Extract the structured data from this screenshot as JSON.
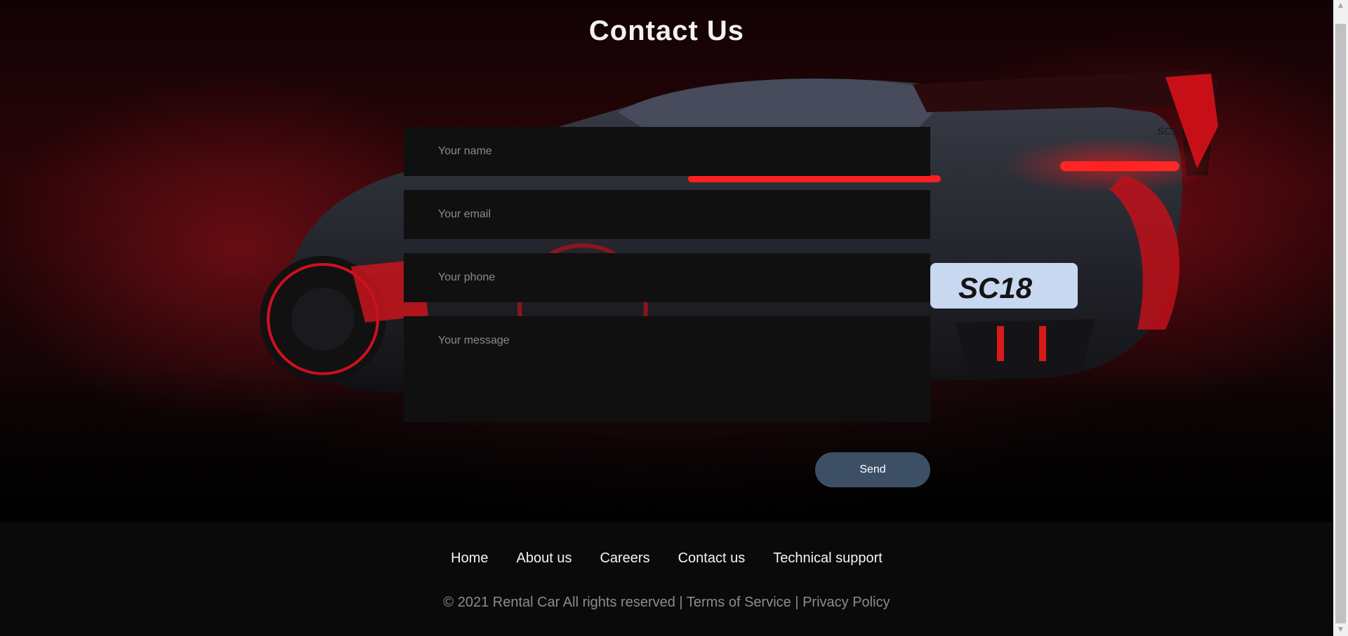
{
  "page": {
    "title": "Contact Us"
  },
  "form": {
    "name_placeholder": "Your name",
    "email_placeholder": "Your email",
    "phone_placeholder": "Your phone",
    "message_placeholder": "Your message",
    "send_label": "Send"
  },
  "hero": {
    "plate_text": "SC18",
    "wing_badge": "SC18"
  },
  "footer": {
    "nav": [
      {
        "label": "Home"
      },
      {
        "label": "About us"
      },
      {
        "label": "Careers"
      },
      {
        "label": "Contact us"
      },
      {
        "label": "Technical support"
      }
    ],
    "copyright": "© 2021 Rental Car All rights reserved",
    "separator": "|",
    "terms": "Terms of Service",
    "privacy": "Privacy Policy"
  },
  "colors": {
    "background": "#050505",
    "field": "#101010",
    "button": "#3d4f65",
    "accent_red": "#e01020"
  },
  "icons": {
    "scroll_up": "triangle-up",
    "scroll_down": "triangle-down"
  }
}
